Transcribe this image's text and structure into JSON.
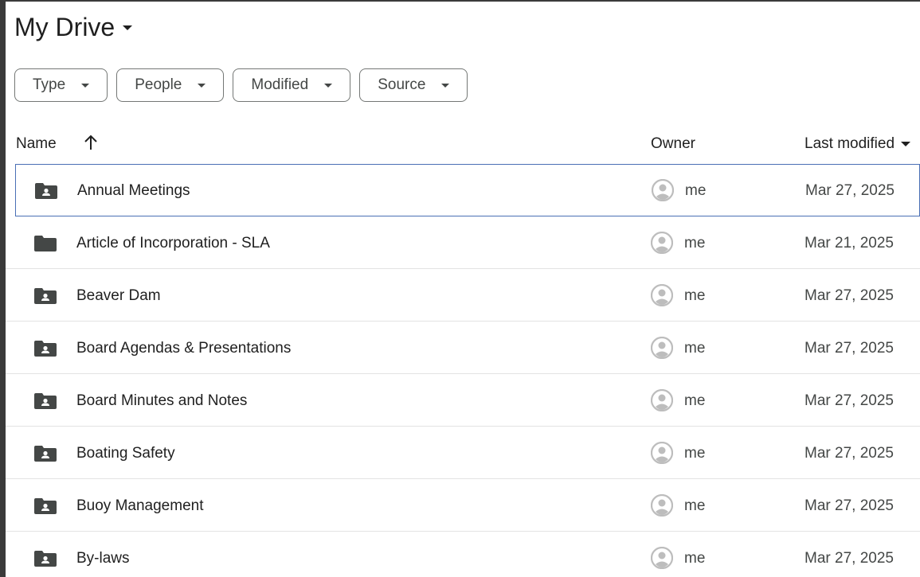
{
  "header": {
    "title": "My Drive"
  },
  "filters": [
    {
      "label": "Type"
    },
    {
      "label": "People"
    },
    {
      "label": "Modified"
    },
    {
      "label": "Source"
    }
  ],
  "columns": {
    "name": "Name",
    "owner": "Owner",
    "last_modified": "Last modified"
  },
  "rows": [
    {
      "name": "Annual Meetings",
      "icon": "shared-folder-icon",
      "owner": "me",
      "modified": "Mar 27, 2025",
      "selected": true
    },
    {
      "name": "Article of Incorporation - SLA",
      "icon": "folder-icon",
      "owner": "me",
      "modified": "Mar 21, 2025"
    },
    {
      "name": "Beaver Dam",
      "icon": "shared-folder-icon",
      "owner": "me",
      "modified": "Mar 27, 2025"
    },
    {
      "name": "Board Agendas & Presentations",
      "icon": "shared-folder-icon",
      "owner": "me",
      "modified": "Mar 27, 2025"
    },
    {
      "name": "Board Minutes and Notes",
      "icon": "shared-folder-icon",
      "owner": "me",
      "modified": "Mar 27, 2025"
    },
    {
      "name": "Boating Safety",
      "icon": "shared-folder-icon",
      "owner": "me",
      "modified": "Mar 27, 2025"
    },
    {
      "name": "Buoy Management",
      "icon": "shared-folder-icon",
      "owner": "me",
      "modified": "Mar 27, 2025"
    },
    {
      "name": "By-laws",
      "icon": "shared-folder-icon",
      "owner": "me",
      "modified": "Mar 27, 2025"
    }
  ],
  "colors": {
    "text": "#1f1f1f",
    "muted": "#444746",
    "folder": "#444746",
    "avatar": "#bdbdbd",
    "selection_border": "#4a6fb5",
    "divider": "#e3e3e3"
  }
}
